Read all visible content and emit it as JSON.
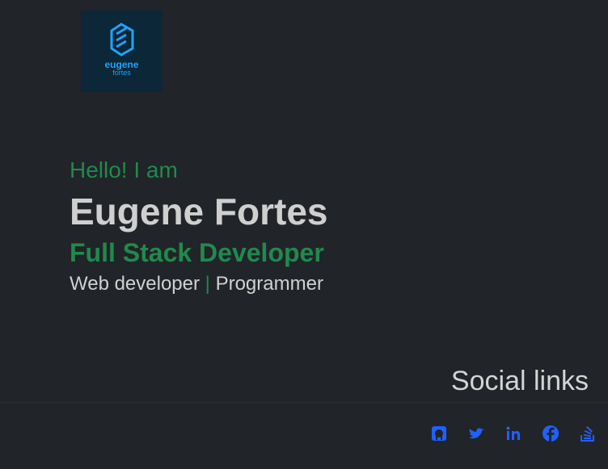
{
  "logo": {
    "name": "eugene",
    "sub": "fortes"
  },
  "hero": {
    "greeting": "Hello! I am",
    "name": "Eugene Fortes",
    "role": "Full Stack Developer",
    "tagline_a": "Web developer",
    "separator": "|",
    "tagline_b": "Programmer"
  },
  "social": {
    "title": "Social links",
    "links": [
      "github-icon",
      "twitter-icon",
      "linkedin-icon",
      "facebook-icon",
      "stackoverflow-icon"
    ]
  },
  "colors": {
    "background": "#212428",
    "accent": "#1f8a4c",
    "link": "#2060ff",
    "logo_bg": "#0b2738"
  }
}
